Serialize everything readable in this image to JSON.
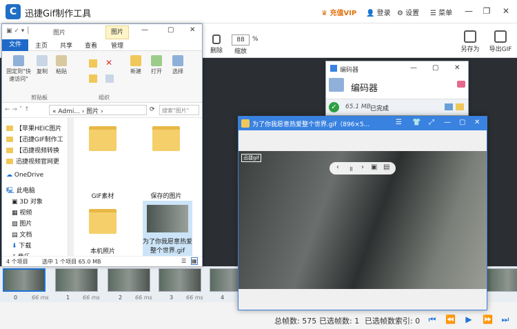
{
  "app": {
    "title": "迅捷Gif制作工具",
    "vip": "充值VIP",
    "login": "登录",
    "settings": "设置",
    "menu": "菜单",
    "logo": "C",
    "delete_label": "删除",
    "zoom_value": "88",
    "zoom_unit": "%",
    "zoom_label": "缩放",
    "save_as": "另存为",
    "export_gif": "导出GIF"
  },
  "filmstrip": {
    "frames": [
      {
        "index": "0",
        "duration": "66 ms"
      },
      {
        "index": "1",
        "duration": "66 ms"
      },
      {
        "index": "2",
        "duration": "66 ms"
      },
      {
        "index": "3",
        "duration": "66 ms"
      },
      {
        "index": "4",
        "duration": "66 ms"
      }
    ]
  },
  "status": {
    "total_frames": "总帧数: 575",
    "selected_frames": "已选帧数: 1",
    "selected_index": "已选帧数索引: 0"
  },
  "explorer": {
    "title": "图片",
    "tab_file": "文件",
    "tab_home": "主页",
    "tab_share": "共享",
    "tab_view": "查看",
    "tab_manage": "管理",
    "tab_picture": "图片",
    "pin_label": "固定到\"快速访问\"",
    "copy": "复制",
    "paste": "粘贴",
    "clipboard_group": "剪贴板",
    "organize_group": "组织",
    "new_label": "新建",
    "open_label": "打开",
    "select_label": "选择",
    "breadcrumb": "« Admi... › 图片 ›",
    "search_placeholder": "搜索\"图片\"",
    "nav": [
      "【苹果HEIC图片",
      "【迅捷GIF制作工",
      "【迅捷视频转换",
      "迅捷视频官网更",
      "OneDrive",
      "此电脑",
      "3D 对象",
      "视频",
      "图片",
      "文档",
      "下载",
      "音乐"
    ],
    "items": [
      "GIF素材",
      "保存的图片",
      "本机照片",
      "为了你我愿意热爱整个世界.gif"
    ],
    "status_count": "4 个项目",
    "status_sel": "选中 1 个项目 65.0 MB"
  },
  "encoder": {
    "title": "编码器",
    "heading": "编码器",
    "size": "65.1 MB",
    "done": "已完成"
  },
  "player": {
    "title": "为了你我愿意热爱整个世界.gif（896×5...",
    "watermark": "迅捷gif"
  }
}
